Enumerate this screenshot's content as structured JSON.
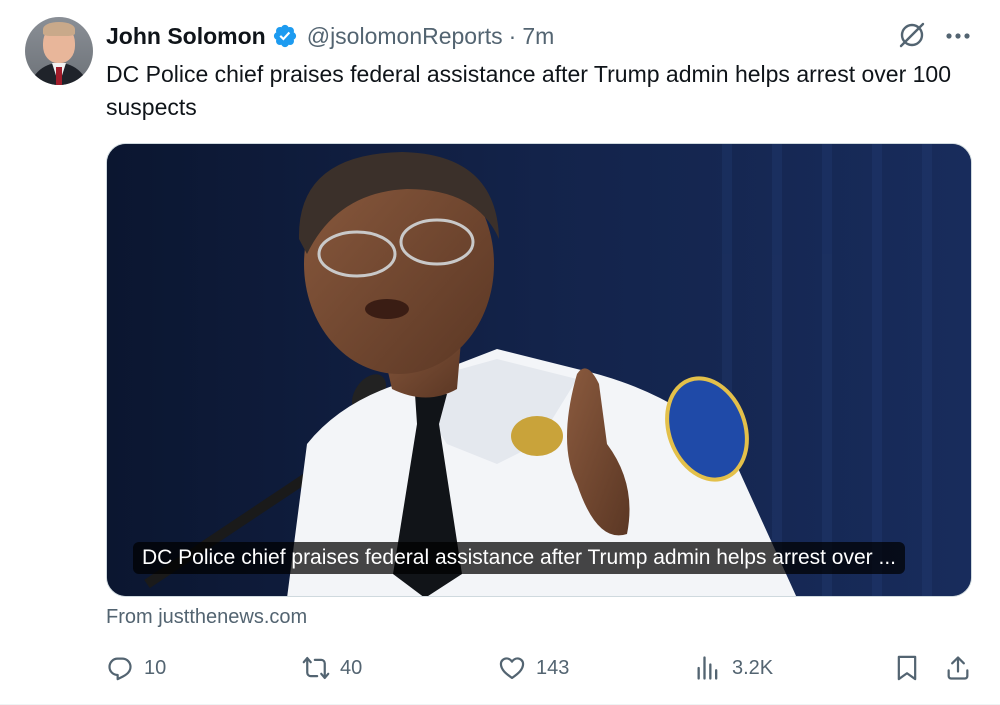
{
  "author": {
    "display_name": "John Solomon",
    "handle": "@jsolomonReports",
    "separator": "·",
    "time": "7m",
    "verified_color": "#1d9bf0"
  },
  "tweet": {
    "text": "DC Police chief praises federal assistance after Trump admin helps arrest over 100 suspects"
  },
  "card": {
    "caption": "DC Police chief praises federal assistance after Trump admin helps arrest over ...",
    "source": "From justthenews.com"
  },
  "actions": {
    "replies": "10",
    "reposts": "40",
    "likes": "143",
    "views": "3.2K"
  },
  "icons": {
    "grok": "grok-icon",
    "more": "more-icon",
    "reply": "reply-icon",
    "repost": "repost-icon",
    "like": "heart-icon",
    "views": "views-chart-icon",
    "bookmark": "bookmark-icon",
    "share": "share-icon"
  },
  "colors": {
    "text": "#0f1419",
    "secondary": "#536471",
    "accent": "#1d9bf0",
    "border": "#cfd9de"
  }
}
